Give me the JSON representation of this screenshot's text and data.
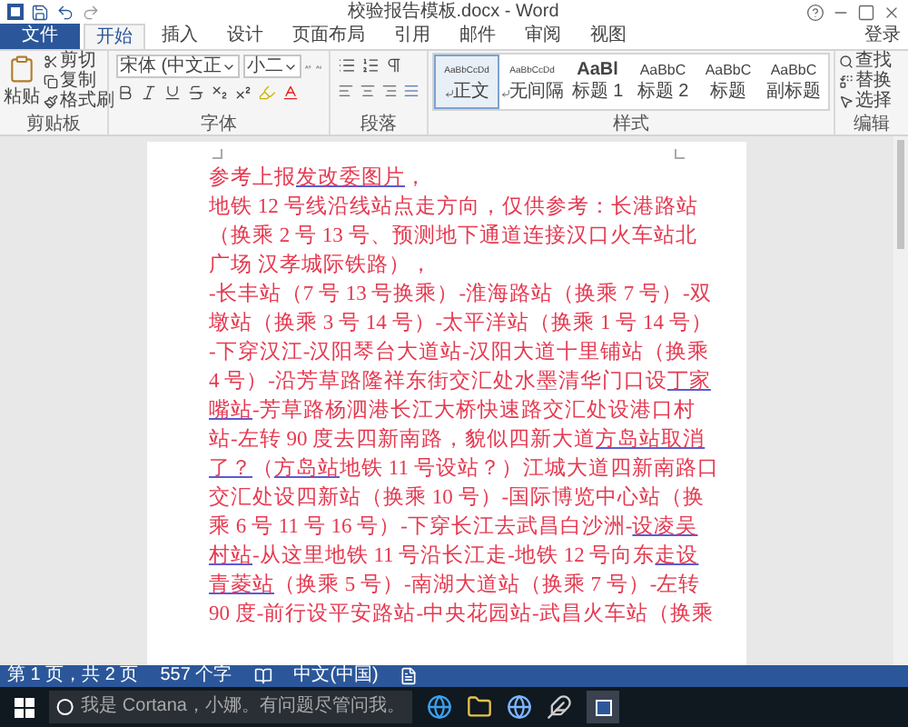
{
  "window": {
    "title": "校验报告模板.docx - Word"
  },
  "ribbon_tabs": [
    {
      "label": "文件",
      "kind": "file",
      "selected": false
    },
    {
      "label": "开始",
      "kind": "tab",
      "selected": true
    },
    {
      "label": "插入",
      "kind": "tab",
      "selected": false
    },
    {
      "label": "设计",
      "kind": "tab",
      "selected": false
    },
    {
      "label": "页面布局",
      "kind": "tab",
      "selected": false
    },
    {
      "label": "引用",
      "kind": "tab",
      "selected": false
    },
    {
      "label": "邮件",
      "kind": "tab",
      "selected": false
    },
    {
      "label": "审阅",
      "kind": "tab",
      "selected": false
    },
    {
      "label": "视图",
      "kind": "tab",
      "selected": false
    }
  ],
  "sign_in": "登录",
  "clipboard": {
    "paste": "粘贴",
    "items": [
      "剪切",
      "复制",
      "格式刷"
    ],
    "label": "剪贴板"
  },
  "font": {
    "name": "宋体 (中文正",
    "size": "小二",
    "label": "字体"
  },
  "paragraph": {
    "label": "段落"
  },
  "styles": {
    "label": "样式",
    "items": [
      {
        "sample": "AaBbCcDd",
        "name": "正文",
        "paragraph_mark": true,
        "selected": true
      },
      {
        "sample": "AaBbCcDd",
        "name": "无间隔",
        "paragraph_mark": true,
        "selected": false
      },
      {
        "sample": "AaBl",
        "name": "标题 1",
        "paragraph_mark": false,
        "selected": false
      },
      {
        "sample": "AaBbC",
        "name": "标题 2",
        "paragraph_mark": false,
        "selected": false
      },
      {
        "sample": "AaBbC",
        "name": "标题",
        "paragraph_mark": false,
        "selected": false
      },
      {
        "sample": "AaBbC",
        "name": "副标题",
        "paragraph_mark": false,
        "selected": false
      }
    ]
  },
  "editing": {
    "items": [
      "查找",
      "替换",
      "选择"
    ],
    "label": "编辑"
  },
  "document": {
    "lines": [
      [
        {
          "text": "参考上报",
          "link": false
        },
        {
          "text": "发改委图片",
          "link": true
        },
        {
          "text": "，",
          "link": false
        }
      ],
      [
        {
          "text": "地铁 12 号线沿线站点走方向，仅供参考：长港路站",
          "link": false
        }
      ],
      [
        {
          "text": "（换乘 2 号 13 号、预测地下通道连接汉口火车站北",
          "link": false
        }
      ],
      [
        {
          "text": "广场 汉孝城际铁路），",
          "link": false
        }
      ],
      [
        {
          "text": "-长丰站（7 号 13 号换乘）-淮海路站（换乘 7 号）-双",
          "link": false
        }
      ],
      [
        {
          "text": "墩站（换乘 3 号 14 号）-太平洋站（换乘 1 号 14 号）",
          "link": false
        }
      ],
      [
        {
          "text": "-下穿汉江-汉阳琴台大道站-汉阳大道十里铺站（换乘",
          "link": false
        }
      ],
      [
        {
          "text": "4 号）-沿芳草路隆祥东街交汇处水墨清华门口设",
          "link": false
        },
        {
          "text": "丁家",
          "link": true
        }
      ],
      [
        {
          "text": "嘴站",
          "link": true
        },
        {
          "text": "-芳草路杨泗港长江大桥快速路交汇处设港口村",
          "link": false
        }
      ],
      [
        {
          "text": "站-左转 90 度去四新南路，貌似四新大道",
          "link": false
        },
        {
          "text": "方岛站取消",
          "link": true
        }
      ],
      [
        {
          "text": "了？",
          "link": true
        },
        {
          "text": "（",
          "link": false
        },
        {
          "text": "方岛站",
          "link": true
        },
        {
          "text": "地铁 11 号设站？）江城大道四新南路口",
          "link": false
        }
      ],
      [
        {
          "text": "交汇处设四新站（换乘 10 号）-国际博览中心站（换",
          "link": false
        }
      ],
      [
        {
          "text": "乘 6 号 11 号 16 号）-下穿长江去武昌白沙洲-",
          "link": false
        },
        {
          "text": "设凌吴",
          "link": true
        }
      ],
      [
        {
          "text": "村站",
          "link": true
        },
        {
          "text": "-从这里地铁 11 号沿长江走-地铁 12 号向东",
          "link": false
        },
        {
          "text": "走设",
          "link": true
        }
      ],
      [
        {
          "text": "青菱站",
          "link": true
        },
        {
          "text": "（换乘 5 号）-南湖大道站（换乘 7 号）-左转",
          "link": false
        }
      ],
      [
        {
          "text": "90 度-前行设平安路站-中央花园站-武昌火车站（换乘",
          "link": false
        }
      ]
    ]
  },
  "status_bar": {
    "page": "第 1 页，共 2 页",
    "words": "557 个字",
    "language": "中文(中国)"
  },
  "taskbar": {
    "search_placeholder": "我是 Cortana，小娜。有问题尽管问我。"
  }
}
